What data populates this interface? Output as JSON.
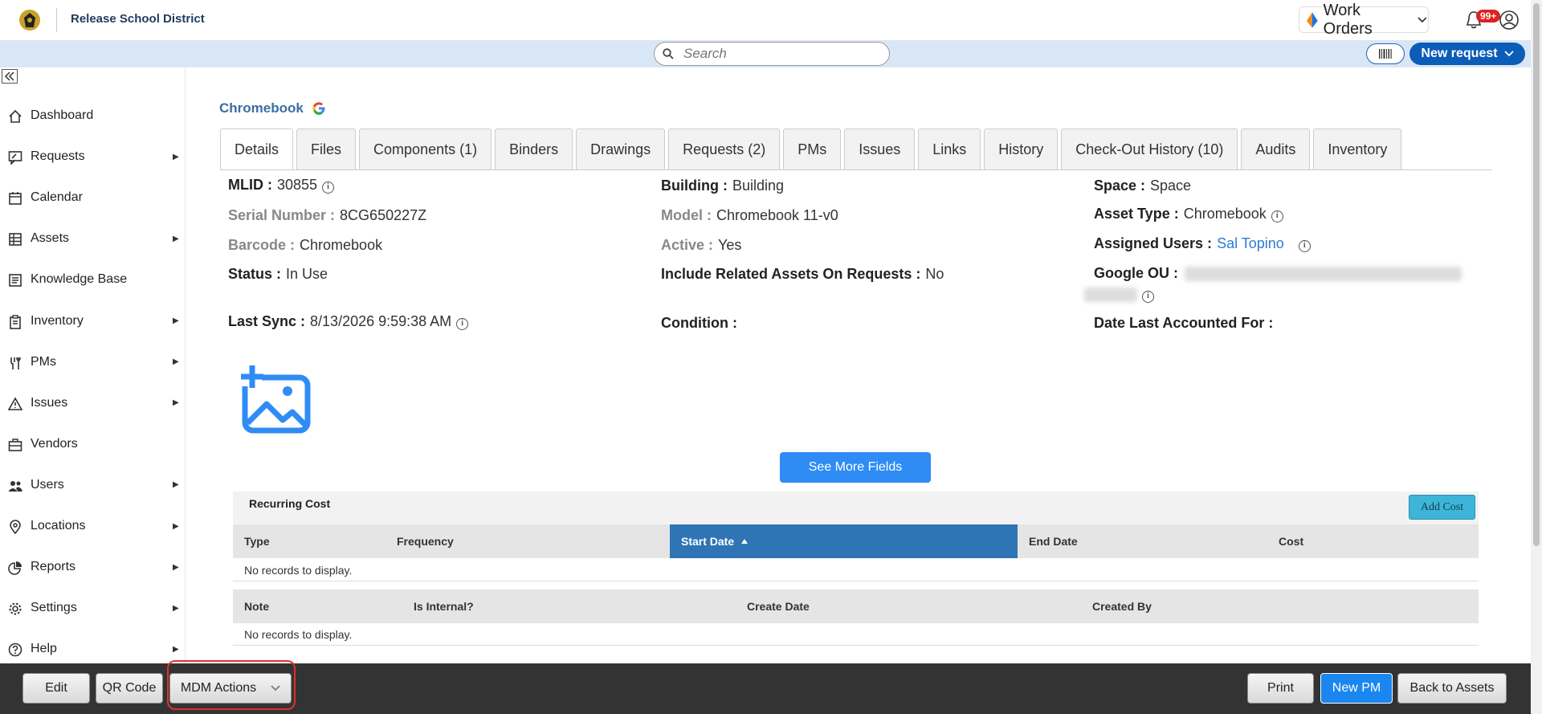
{
  "header": {
    "org_name": "Release School District",
    "module": "Work Orders",
    "notification_count": "99+"
  },
  "search": {
    "placeholder": "Search"
  },
  "new_request_label": "New request",
  "sidebar": {
    "items": [
      {
        "label": "Dashboard",
        "icon": "home-icon",
        "has_submenu": false
      },
      {
        "label": "Requests",
        "icon": "wrench-chat-icon",
        "has_submenu": true
      },
      {
        "label": "Calendar",
        "icon": "calendar-icon",
        "has_submenu": false
      },
      {
        "label": "Assets",
        "icon": "assets-grid-icon",
        "has_submenu": true
      },
      {
        "label": "Knowledge Base",
        "icon": "book-icon",
        "has_submenu": false
      },
      {
        "label": "Inventory",
        "icon": "clipboard-icon",
        "has_submenu": true
      },
      {
        "label": "PMs",
        "icon": "tools-icon",
        "has_submenu": true
      },
      {
        "label": "Issues",
        "icon": "warning-icon",
        "has_submenu": true
      },
      {
        "label": "Vendors",
        "icon": "briefcase-icon",
        "has_submenu": false
      },
      {
        "label": "Users",
        "icon": "users-icon",
        "has_submenu": true
      },
      {
        "label": "Locations",
        "icon": "location-pin-icon",
        "has_submenu": true
      },
      {
        "label": "Reports",
        "icon": "pie-chart-icon",
        "has_submenu": true
      },
      {
        "label": "Settings",
        "icon": "gear-icon",
        "has_submenu": true
      },
      {
        "label": "Help",
        "icon": "help-icon",
        "has_submenu": true
      }
    ]
  },
  "asset": {
    "title": "Chromebook",
    "tabs": [
      "Details",
      "Files",
      "Components (1)",
      "Binders",
      "Drawings",
      "Requests (2)",
      "PMs",
      "Issues",
      "Links",
      "History",
      "Check-Out History (10)",
      "Audits",
      "Inventory"
    ],
    "active_tab": "Details",
    "fields": {
      "mlid": {
        "label": "MLID :",
        "value": "30855"
      },
      "serial": {
        "label": "Serial Number :",
        "value": "8CG650227Z"
      },
      "barcode": {
        "label": "Barcode :",
        "value": "Chromebook"
      },
      "status": {
        "label": "Status :",
        "value": "In Use"
      },
      "last_sync": {
        "label": "Last Sync :",
        "value": "8/13/2026 9:59:38 AM"
      },
      "building": {
        "label": "Building :",
        "value": "Building"
      },
      "model": {
        "label": "Model :",
        "value": "Chromebook 11-v0"
      },
      "active": {
        "label": "Active :",
        "value": "Yes"
      },
      "include_related": {
        "label": "Include Related Assets On Requests :",
        "value": "No"
      },
      "condition": {
        "label": "Condition :",
        "value": ""
      },
      "space": {
        "label": "Space :",
        "value": "Space"
      },
      "asset_type": {
        "label": "Asset Type :",
        "value": "Chromebook"
      },
      "assigned_users": {
        "label": "Assigned Users :",
        "value": "Sal Topino"
      },
      "google_ou": {
        "label": "Google OU :"
      },
      "date_last_accounted": {
        "label": "Date Last Accounted For :",
        "value": ""
      }
    },
    "see_more_label": "See More Fields"
  },
  "recurring_cost": {
    "title": "Recurring Cost",
    "add_label": "Add Cost",
    "columns": [
      "Type",
      "Frequency",
      "Start Date",
      "End Date",
      "Cost"
    ],
    "sorted_column": "Start Date",
    "empty_text": "No records to display."
  },
  "notes": {
    "columns": [
      "Note",
      "Is Internal?",
      "Create Date",
      "Created By"
    ],
    "empty_text": "No records to display."
  },
  "bottom_bar": {
    "edit": "Edit",
    "qr": "QR Code",
    "mdm": "MDM Actions",
    "print": "Print",
    "new_pm": "New PM",
    "back": "Back to Assets"
  },
  "colors": {
    "accent": "#0c5db8",
    "strip": "#d9e6f5",
    "sorted_header": "#2f74b5",
    "bottom_bar": "#333333",
    "highlight": "#e03030"
  }
}
